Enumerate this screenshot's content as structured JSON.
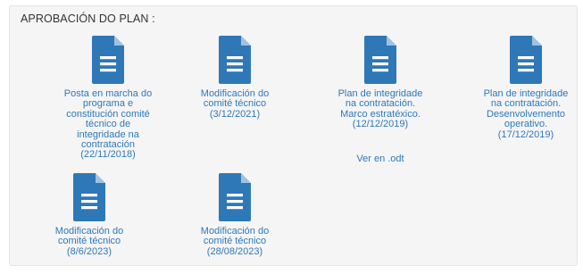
{
  "section": {
    "title": "APROBACIÓN DO PLAN :"
  },
  "documents": [
    {
      "icon": "document-icon",
      "lines": [
        "Posta en marcha do",
        "programa e",
        "constitución comité",
        "técnico de",
        "integridade na",
        "contratación",
        "(22/11/2018)"
      ]
    },
    {
      "icon": "document-icon",
      "lines": [
        "Modificación do",
        "comité técnico",
        "(3/12/2021)"
      ]
    },
    {
      "icon": "document-icon",
      "lines": [
        "Plan de integridade",
        "na contratación.",
        "Marco estratéxico.",
        "(12/12/2019)"
      ],
      "extra_link": "Ver en .odt"
    },
    {
      "icon": "document-icon",
      "lines": [
        "Plan de integridade",
        "na contratación.",
        "Desenvolvemento",
        "operativo.",
        "(17/12/2019)"
      ]
    },
    {
      "icon": "document-icon",
      "lines": [
        "Modificación do",
        "comité técnico",
        "(8/6/2023)"
      ]
    },
    {
      "icon": "document-icon",
      "lines": [
        "Modificación do",
        "comité técnico",
        "(28/08/2023)"
      ]
    }
  ],
  "colors": {
    "icon_blue": "#2f78b8",
    "link_blue": "#2f78b8",
    "panel_bg": "#f5f5f6"
  }
}
